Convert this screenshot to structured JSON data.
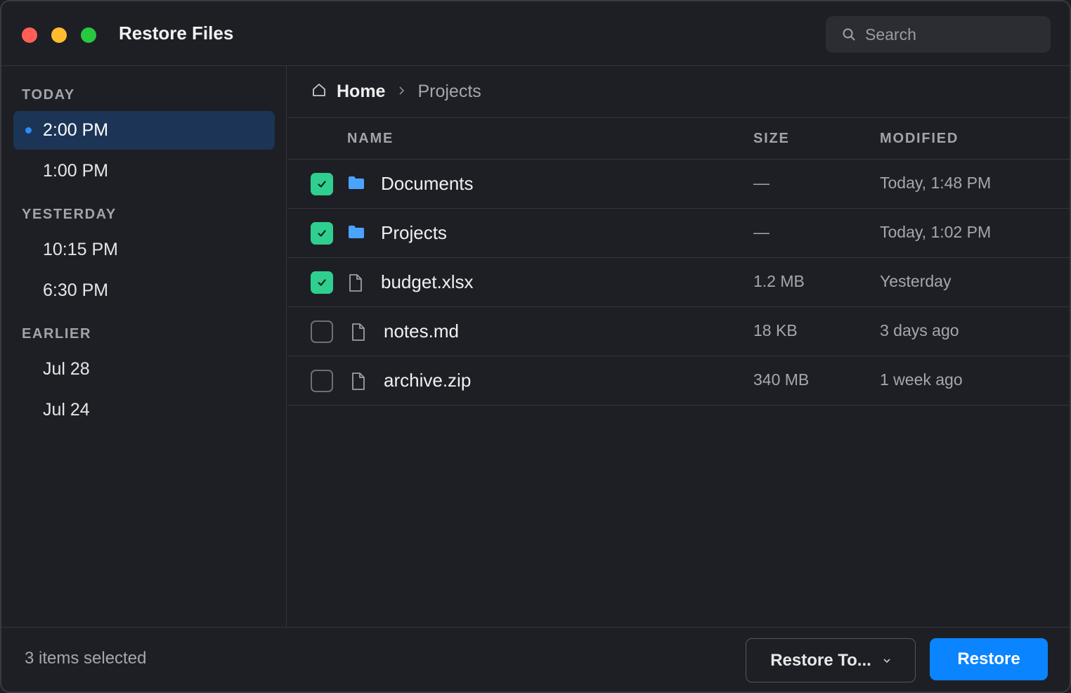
{
  "window": {
    "title": "Restore Files",
    "search_placeholder": "Search"
  },
  "sidebar": {
    "groups": [
      {
        "label": "TODAY",
        "items": [
          {
            "label": "2:00 PM",
            "active": true
          },
          {
            "label": "1:00 PM",
            "active": false
          }
        ]
      },
      {
        "label": "YESTERDAY",
        "items": [
          {
            "label": "10:15 PM",
            "active": false
          },
          {
            "label": "6:30 PM",
            "active": false
          }
        ]
      },
      {
        "label": "EARLIER",
        "items": [
          {
            "label": "Jul 28",
            "active": false
          },
          {
            "label": "Jul 24",
            "active": false
          }
        ]
      }
    ]
  },
  "breadcrumb": {
    "home": "Home",
    "current": "Projects"
  },
  "table": {
    "headers": {
      "name": "NAME",
      "size": "SIZE",
      "modified": "MODIFIED"
    },
    "rows": [
      {
        "checked": true,
        "icon": "folder-icon",
        "name": "Documents",
        "size": "—",
        "modified": "Today, 1:48 PM"
      },
      {
        "checked": true,
        "icon": "folder-icon",
        "name": "Projects",
        "size": "—",
        "modified": "Today, 1:02 PM"
      },
      {
        "checked": true,
        "icon": "file-icon",
        "name": "budget.xlsx",
        "size": "1.2 MB",
        "modified": "Yesterday"
      },
      {
        "checked": false,
        "icon": "file-icon",
        "name": "notes.md",
        "size": "18 KB",
        "modified": "3 days ago"
      },
      {
        "checked": false,
        "icon": "file-icon",
        "name": "archive.zip",
        "size": "340 MB",
        "modified": "1 week ago"
      }
    ]
  },
  "footer": {
    "selected_count": "3 items selected",
    "restore_to_label": "Restore To...",
    "restore_label": "Restore"
  },
  "colors": {
    "accent": "#0a84ff",
    "checkbox_checked": "#2fcf8f",
    "folder": "#4aa3ff",
    "active_item_bg": "#1c3556"
  }
}
